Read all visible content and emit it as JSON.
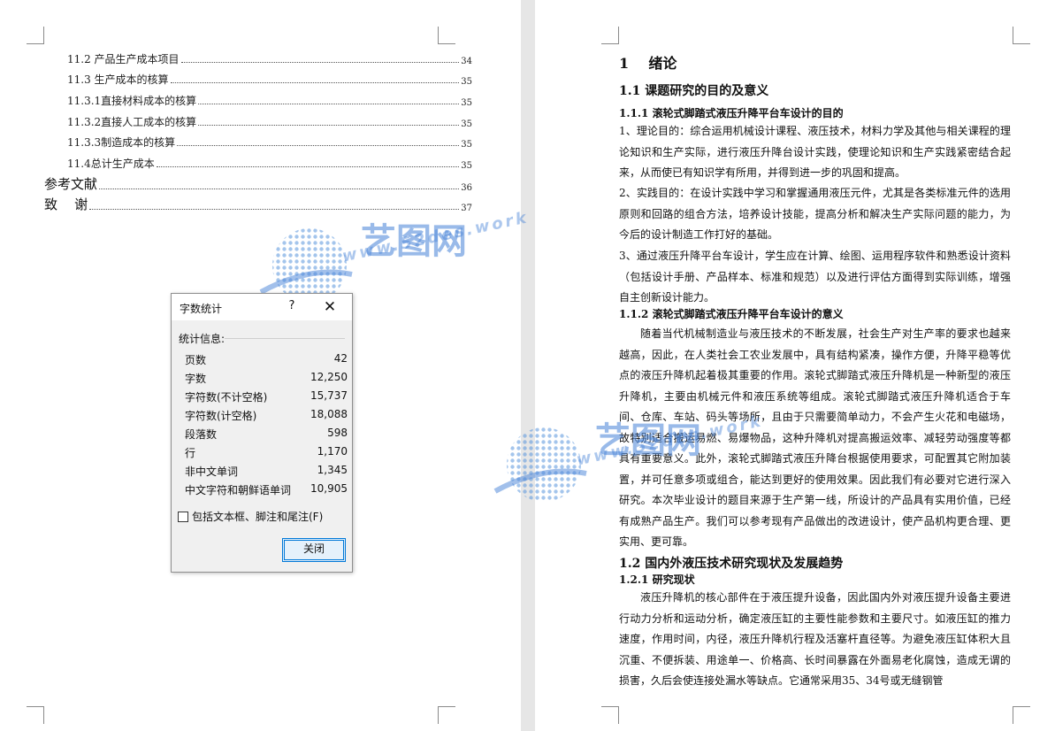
{
  "toc": [
    {
      "text": "11.2  产品生产成本项目",
      "page": "34"
    },
    {
      "text": "11.3  生产成本的核算",
      "page": "35"
    },
    {
      "text": "11.3.1直接材料成本的核算",
      "page": "35"
    },
    {
      "text": "11.3.2直接人工成本的核算",
      "page": "35"
    },
    {
      "text": "11.3.3制造成本的核算",
      "page": "35"
    },
    {
      "text": "11.4总计生产成本",
      "page": "35"
    },
    {
      "text": "参考文献",
      "page": "36"
    },
    {
      "text": "致    谢",
      "page": "37"
    }
  ],
  "doc": {
    "h1": "1    绪论",
    "s1_1": "1.1 课题研究的目的及意义",
    "s1_1_1": "1.1.1 滚轮式脚踏式液压升降平台车设计的目的",
    "p1": "1、理论目的：综合运用机械设计课程、液压技术，材料力学及其他与相关课程的理论知识和生产实际，进行液压升降台设计实践，使理论知识和生产实践紧密结合起来，从而使已有知识学有所用，并得到进一步的巩固和提高。",
    "p2": "2、实践目的：在设计实践中学习和掌握通用液压元件，尤其是各类标准元件的选用原则和回路的组合方法，培养设计技能，提高分析和解决生产实际问题的能力，为今后的设计制造工作打好的基础。",
    "p3": "3、通过液压升降平台车设计，学生应在计算、绘图、运用程序软件和熟悉设计资料（包括设计手册、产品样本、标准和规范）以及进行评估方面得到实际训练，增强自主创新设计能力。",
    "s1_1_2": "1.1.2 滚轮式脚踏式液压升降平台车设计的意义",
    "p4": "随着当代机械制造业与液压技术的不断发展，社会生产对生产率的要求也越来越高，因此，在人类社会工农业发展中，具有结构紧凑，操作方便，升降平稳等优点的液压升降机起着极其重要的作用。滚轮式脚踏式液压升降机是一种新型的液压升降机，主要由机械元件和液压系统等组成。滚轮式脚踏式液压升降机适合于车间、仓库、车站、码头等场所，且由于只需要简单动力，不会产生火花和电磁场，故特别适合搬运易燃、易爆物品，这种升降机对提高搬运效率、减轻劳动强度等都具有重要意义。此外，滚轮式脚踏式液压升降台根据使用要求，可配置其它附加装置，并可任意多项或组合，能达到更好的使用效果。因此我们有必要对它进行深入研究。本次毕业设计的题目来源于生产第一线，所设计的产品具有实用价值，已经有成熟产品生产。我们可以参考现有产品做出的改进设计，使产品机构更合理、更实用、更可靠。",
    "s1_2": "1.2 国内外液压技术研究现状及发展趋势",
    "s1_2_1": "1.2.1 研究现状",
    "p5": "液压升降机的核心部件在于液压提升设备，因此国内外对液压提升设备主要进行动力分析和运动分析，确定液压缸的主要性能参数和主要尺寸。如液压缸的推力速度，作用时间，内径，液压升降机行程及活塞杆直径等。为避免液压缸体积大且沉重、不便拆装、用途单一、价格高、长时间暴露在外面易老化腐蚀，造成无谓的损害，久后会使连接处漏水等缺点。它通常采用35、34号或无缝钢管"
  },
  "watermark": {
    "brand": "艺图网",
    "url": "www.52des.work"
  },
  "dialog": {
    "title": "字数统计",
    "help": "?",
    "section": "统计信息:",
    "stats": [
      {
        "label": "页数",
        "value": "42"
      },
      {
        "label": "字数",
        "value": "12,250"
      },
      {
        "label": "字符数(不计空格)",
        "value": "15,737"
      },
      {
        "label": "字符数(计空格)",
        "value": "18,088"
      },
      {
        "label": "段落数",
        "value": "598"
      },
      {
        "label": "行",
        "value": "1,170"
      },
      {
        "label": "非中文单词",
        "value": "1,345"
      },
      {
        "label": "中文字符和朝鲜语单词",
        "value": "10,905"
      }
    ],
    "checkbox_label": "包括文本框、脚注和尾注(F)",
    "close_button": "关闭"
  }
}
